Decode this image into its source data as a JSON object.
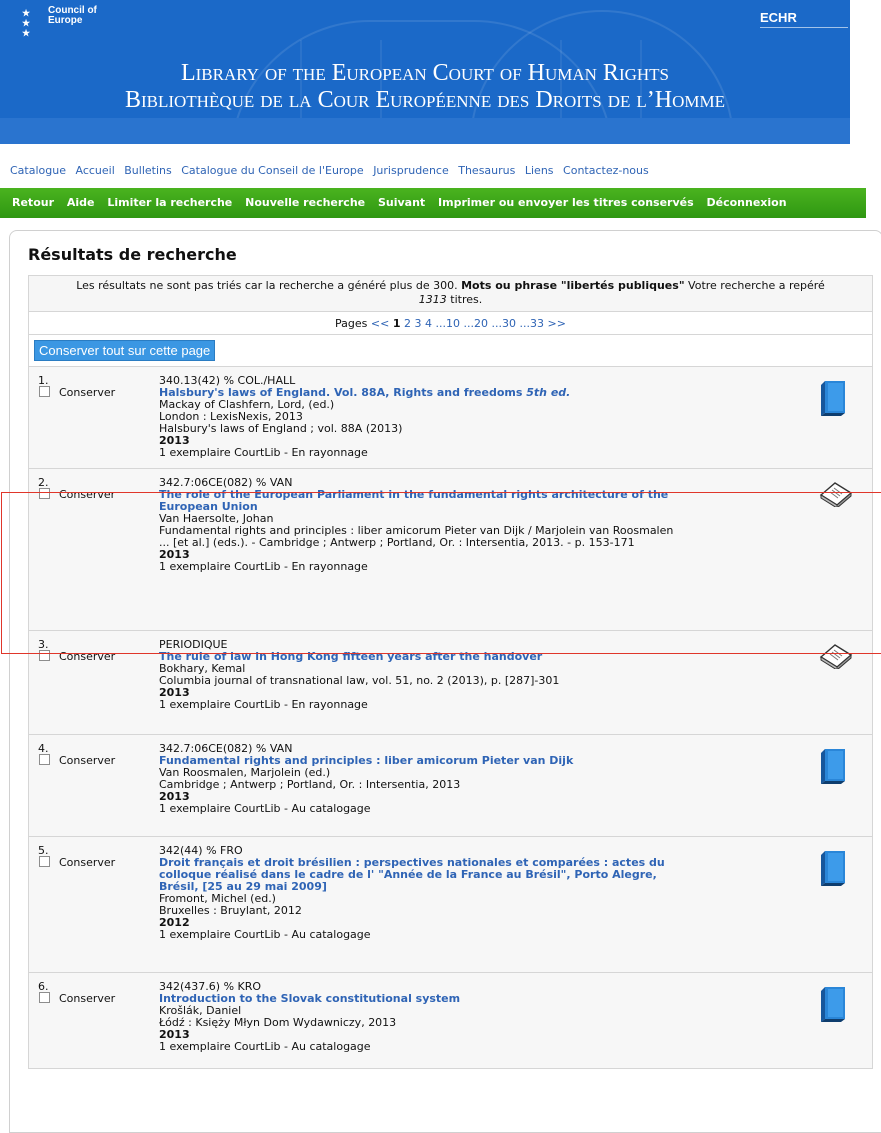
{
  "banner": {
    "logo_text_line1": "Council of",
    "logo_text_line2": "Europe",
    "echr": "ECHR",
    "title_en": "Library of the European Court of Human Rights",
    "title_fr": "Bibliothèque de la Cour Européenne des Droits de l’Homme"
  },
  "topnav": [
    "Catalogue",
    "Accueil",
    "Bulletins",
    "Catalogue du Conseil de l'Europe",
    "Jurisprudence",
    "Thesaurus",
    "Liens",
    "Contactez-nous"
  ],
  "actionbar": [
    "Retour",
    "Aide",
    "Limiter la recherche",
    "Nouvelle recherche",
    "Suivant",
    "Imprimer ou envoyer les titres conservés",
    "Déconnexion"
  ],
  "results": {
    "heading": "Résultats de recherche",
    "info_prefix": "Les résultats ne sont pas triés car la recherche a généré plus de 300.",
    "info_bold": "Mots ou phrase \"libertés publiques\"",
    "info_mid": "Votre recherche a repéré",
    "info_count": "1313",
    "info_suffix": "titres.",
    "pages_label": "Pages",
    "pages_prev": "<<",
    "pages_current": "1",
    "pages_links": [
      "2",
      "3",
      "4",
      "...10",
      "...20",
      "...30",
      "...33"
    ],
    "pages_next": ">>",
    "save_all": "Conserver tout sur cette page",
    "save_label": "Conserver"
  },
  "records": [
    {
      "num": "1.",
      "call": "340.13(42) % COL./HALL",
      "title": "Halsbury's laws of England. Vol. 88A, Rights and freedoms",
      "title_suffix": "5th ed.",
      "lines": [
        "Mackay of Clashfern, Lord, (ed.)",
        "London : LexisNexis, 2013",
        "Halsbury's laws of England ; vol. 88A (2013)"
      ],
      "year": "2013",
      "holding": "1 exemplaire CourtLib - En rayonnage",
      "icon": "book-icon"
    },
    {
      "num": "2.",
      "call": "342.7:06CE(082) % VAN",
      "title": "The role of the European Parliament in the fundamental rights architecture of the European Union",
      "title_suffix": "",
      "lines": [
        "Van Haersolte, Johan",
        "Fundamental rights and principles : liber amicorum Pieter van Dijk / Marjolein van Roosmalen ... [et al.] (eds.). - Cambridge ; Antwerp ; Portland, Or. : Intersentia, 2013. - p. 153-171"
      ],
      "year": "2013",
      "holding": "1 exemplaire CourtLib - En rayonnage",
      "icon": "article-icon"
    },
    {
      "num": "3.",
      "call": "PERIODIQUE",
      "title": "The rule of law in Hong Kong fifteen years after the handover",
      "title_suffix": "",
      "lines": [
        "Bokhary, Kemal",
        "Columbia journal of transnational law, vol. 51, no. 2 (2013), p. [287]-301"
      ],
      "year": "2013",
      "holding": "1 exemplaire CourtLib - En rayonnage",
      "icon": "article-icon"
    },
    {
      "num": "4.",
      "call": "342.7:06CE(082) % VAN",
      "title": "Fundamental rights and principles : liber amicorum Pieter van Dijk",
      "title_suffix": "",
      "lines": [
        "Van Roosmalen, Marjolein (ed.)",
        "Cambridge ; Antwerp ; Portland, Or. : Intersentia, 2013"
      ],
      "year": "2013",
      "holding": "1 exemplaire CourtLib - Au catalogage",
      "icon": "book-icon"
    },
    {
      "num": "5.",
      "call": "342(44) % FRO",
      "title": "Droit français et droit brésilien : perspectives nationales et comparées : actes du colloque réalisé dans le cadre de l' \"Année de la France au Brésil\", Porto Alegre, Brésil, [25 au 29 mai 2009]",
      "title_suffix": "",
      "lines": [
        "Fromont, Michel (ed.)",
        "Bruxelles : Bruylant, 2012"
      ],
      "year": "2012",
      "holding": "1 exemplaire CourtLib - Au catalogage",
      "icon": "book-icon"
    },
    {
      "num": "6.",
      "call": "342(437.6) % KRO",
      "title": "Introduction to the Slovak constitutional system",
      "title_suffix": "",
      "lines": [
        "Krošlák, Daniel",
        "Łódź : Księży Młyn Dom Wydawniczy, 2013"
      ],
      "year": "2013",
      "holding": "1 exemplaire CourtLib - Au catalogage",
      "icon": "book-icon"
    }
  ]
}
